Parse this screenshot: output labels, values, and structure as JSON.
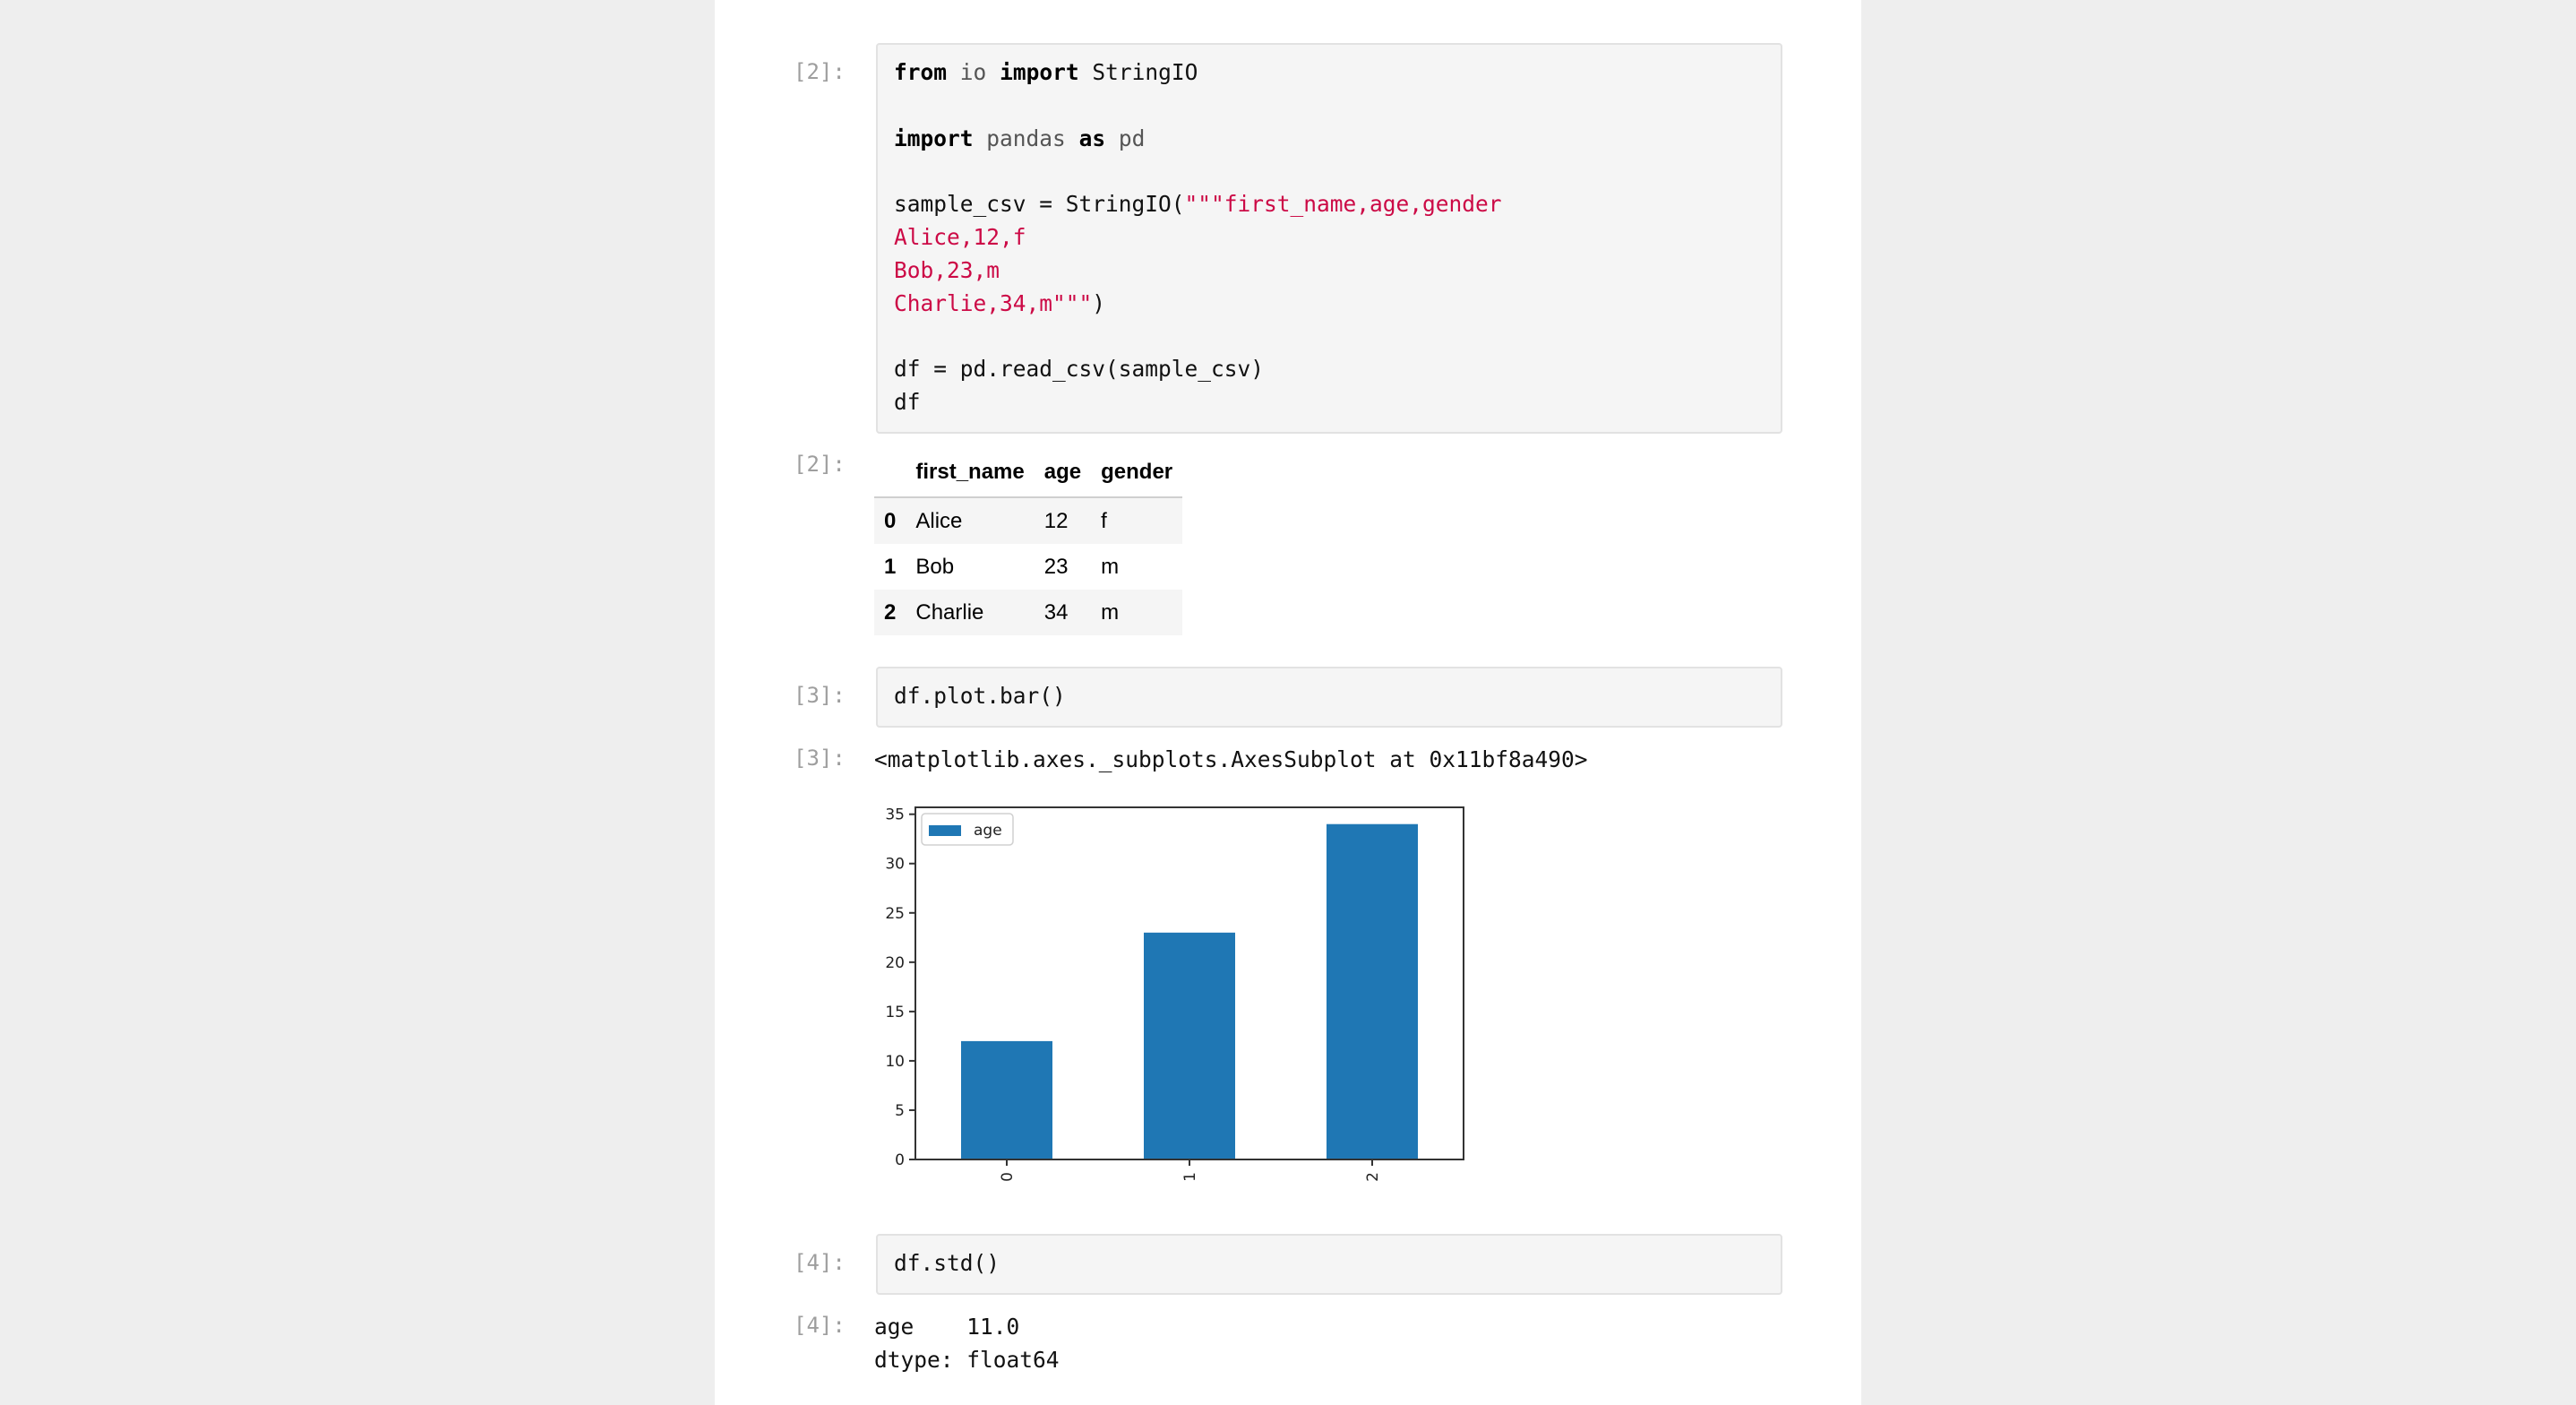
{
  "cells": {
    "c2": {
      "in_prompt": "[2]:",
      "out_prompt": "[2]:",
      "code": {
        "l1_kw_from": "from",
        "l1_mod": "io",
        "l1_kw_import": "import",
        "l1_name": "StringIO",
        "l2_kw_import": "import",
        "l2_mod": "pandas",
        "l2_kw_as": "as",
        "l2_alias": "pd",
        "l3_plain": "sample_csv = StringIO(",
        "l3_str": "\"\"\"first_name,age,gender",
        "l4_str": "Alice,12,f",
        "l5_str": "Bob,23,m",
        "l6_str": "Charlie,34,m\"\"\"",
        "l6_plain": ")",
        "l7": "df = pd.read_csv(sample_csv)",
        "l8": "df"
      },
      "table": {
        "columns": [
          "first_name",
          "age",
          "gender"
        ],
        "rows": [
          {
            "index": "0",
            "first_name": "Alice",
            "age": "12",
            "gender": "f"
          },
          {
            "index": "1",
            "first_name": "Bob",
            "age": "23",
            "gender": "m"
          },
          {
            "index": "2",
            "first_name": "Charlie",
            "age": "34",
            "gender": "m"
          }
        ]
      }
    },
    "c3": {
      "in_prompt": "[3]:",
      "out_prompt": "[3]:",
      "code": "df.plot.bar()",
      "output_text": "<matplotlib.axes._subplots.AxesSubplot at 0x11bf8a490>"
    },
    "c4": {
      "in_prompt": "[4]:",
      "out_prompt": "[4]:",
      "code": "df.std()",
      "output_line1": "age    11.0",
      "output_line2": "dtype: float64"
    }
  },
  "colors": {
    "bar": "#1f77b4",
    "string": "#cc0a46",
    "page_bg": "#eeeeee",
    "code_bg": "#f5f5f5"
  },
  "chart_data": {
    "type": "bar",
    "categories": [
      "0",
      "1",
      "2"
    ],
    "series": [
      {
        "name": "age",
        "values": [
          12,
          23,
          34
        ]
      }
    ],
    "yticks": [
      "0",
      "5",
      "10",
      "15",
      "20",
      "25",
      "30",
      "35"
    ],
    "ylim": [
      0,
      35.7
    ],
    "legend": "top-left",
    "grid": false,
    "title": "",
    "xlabel": "",
    "ylabel": ""
  }
}
